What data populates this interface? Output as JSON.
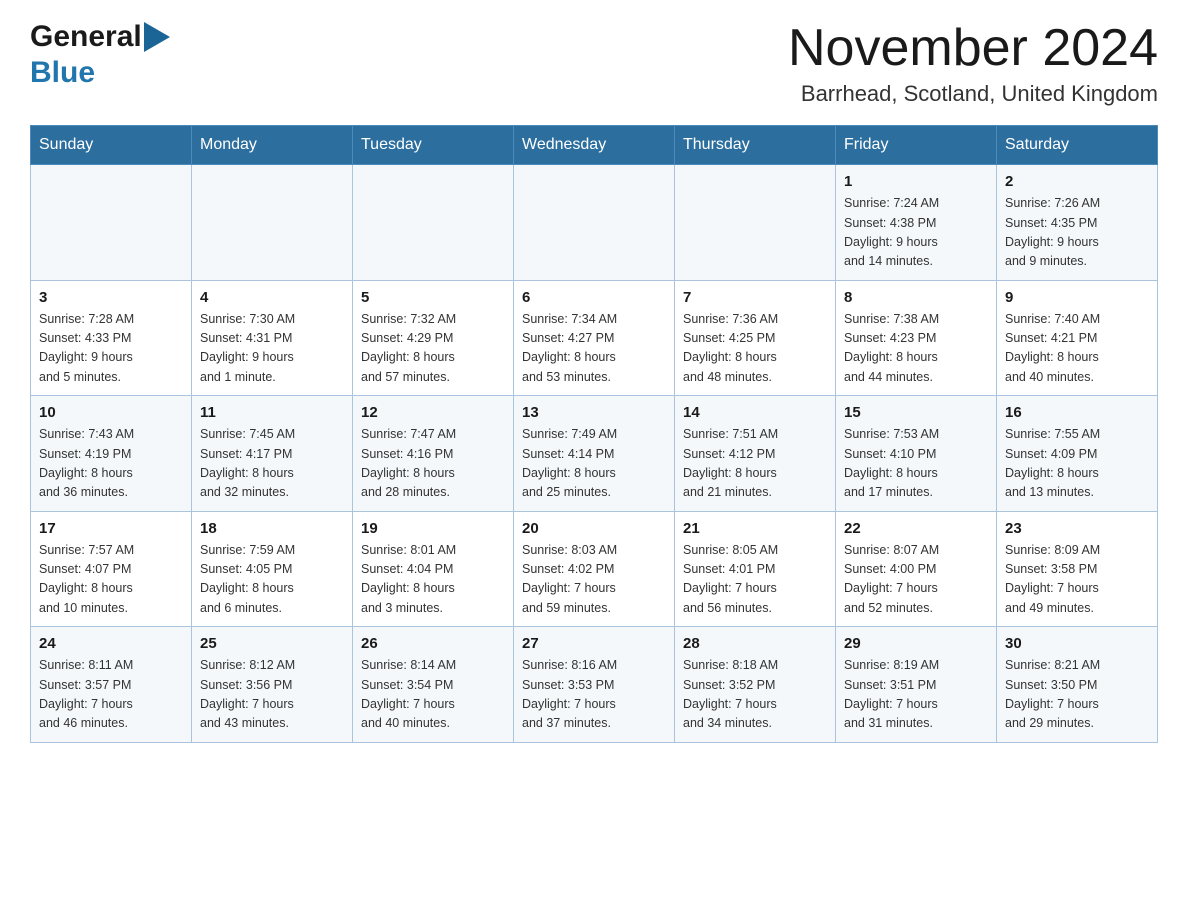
{
  "logo": {
    "general": "General",
    "blue": "Blue",
    "triangle_color": "#1a6496"
  },
  "title": {
    "month_year": "November 2024",
    "location": "Barrhead, Scotland, United Kingdom"
  },
  "weekdays": [
    "Sunday",
    "Monday",
    "Tuesday",
    "Wednesday",
    "Thursday",
    "Friday",
    "Saturday"
  ],
  "weeks": [
    [
      {
        "day": "",
        "info": ""
      },
      {
        "day": "",
        "info": ""
      },
      {
        "day": "",
        "info": ""
      },
      {
        "day": "",
        "info": ""
      },
      {
        "day": "",
        "info": ""
      },
      {
        "day": "1",
        "info": "Sunrise: 7:24 AM\nSunset: 4:38 PM\nDaylight: 9 hours\nand 14 minutes."
      },
      {
        "day": "2",
        "info": "Sunrise: 7:26 AM\nSunset: 4:35 PM\nDaylight: 9 hours\nand 9 minutes."
      }
    ],
    [
      {
        "day": "3",
        "info": "Sunrise: 7:28 AM\nSunset: 4:33 PM\nDaylight: 9 hours\nand 5 minutes."
      },
      {
        "day": "4",
        "info": "Sunrise: 7:30 AM\nSunset: 4:31 PM\nDaylight: 9 hours\nand 1 minute."
      },
      {
        "day": "5",
        "info": "Sunrise: 7:32 AM\nSunset: 4:29 PM\nDaylight: 8 hours\nand 57 minutes."
      },
      {
        "day": "6",
        "info": "Sunrise: 7:34 AM\nSunset: 4:27 PM\nDaylight: 8 hours\nand 53 minutes."
      },
      {
        "day": "7",
        "info": "Sunrise: 7:36 AM\nSunset: 4:25 PM\nDaylight: 8 hours\nand 48 minutes."
      },
      {
        "day": "8",
        "info": "Sunrise: 7:38 AM\nSunset: 4:23 PM\nDaylight: 8 hours\nand 44 minutes."
      },
      {
        "day": "9",
        "info": "Sunrise: 7:40 AM\nSunset: 4:21 PM\nDaylight: 8 hours\nand 40 minutes."
      }
    ],
    [
      {
        "day": "10",
        "info": "Sunrise: 7:43 AM\nSunset: 4:19 PM\nDaylight: 8 hours\nand 36 minutes."
      },
      {
        "day": "11",
        "info": "Sunrise: 7:45 AM\nSunset: 4:17 PM\nDaylight: 8 hours\nand 32 minutes."
      },
      {
        "day": "12",
        "info": "Sunrise: 7:47 AM\nSunset: 4:16 PM\nDaylight: 8 hours\nand 28 minutes."
      },
      {
        "day": "13",
        "info": "Sunrise: 7:49 AM\nSunset: 4:14 PM\nDaylight: 8 hours\nand 25 minutes."
      },
      {
        "day": "14",
        "info": "Sunrise: 7:51 AM\nSunset: 4:12 PM\nDaylight: 8 hours\nand 21 minutes."
      },
      {
        "day": "15",
        "info": "Sunrise: 7:53 AM\nSunset: 4:10 PM\nDaylight: 8 hours\nand 17 minutes."
      },
      {
        "day": "16",
        "info": "Sunrise: 7:55 AM\nSunset: 4:09 PM\nDaylight: 8 hours\nand 13 minutes."
      }
    ],
    [
      {
        "day": "17",
        "info": "Sunrise: 7:57 AM\nSunset: 4:07 PM\nDaylight: 8 hours\nand 10 minutes."
      },
      {
        "day": "18",
        "info": "Sunrise: 7:59 AM\nSunset: 4:05 PM\nDaylight: 8 hours\nand 6 minutes."
      },
      {
        "day": "19",
        "info": "Sunrise: 8:01 AM\nSunset: 4:04 PM\nDaylight: 8 hours\nand 3 minutes."
      },
      {
        "day": "20",
        "info": "Sunrise: 8:03 AM\nSunset: 4:02 PM\nDaylight: 7 hours\nand 59 minutes."
      },
      {
        "day": "21",
        "info": "Sunrise: 8:05 AM\nSunset: 4:01 PM\nDaylight: 7 hours\nand 56 minutes."
      },
      {
        "day": "22",
        "info": "Sunrise: 8:07 AM\nSunset: 4:00 PM\nDaylight: 7 hours\nand 52 minutes."
      },
      {
        "day": "23",
        "info": "Sunrise: 8:09 AM\nSunset: 3:58 PM\nDaylight: 7 hours\nand 49 minutes."
      }
    ],
    [
      {
        "day": "24",
        "info": "Sunrise: 8:11 AM\nSunset: 3:57 PM\nDaylight: 7 hours\nand 46 minutes."
      },
      {
        "day": "25",
        "info": "Sunrise: 8:12 AM\nSunset: 3:56 PM\nDaylight: 7 hours\nand 43 minutes."
      },
      {
        "day": "26",
        "info": "Sunrise: 8:14 AM\nSunset: 3:54 PM\nDaylight: 7 hours\nand 40 minutes."
      },
      {
        "day": "27",
        "info": "Sunrise: 8:16 AM\nSunset: 3:53 PM\nDaylight: 7 hours\nand 37 minutes."
      },
      {
        "day": "28",
        "info": "Sunrise: 8:18 AM\nSunset: 3:52 PM\nDaylight: 7 hours\nand 34 minutes."
      },
      {
        "day": "29",
        "info": "Sunrise: 8:19 AM\nSunset: 3:51 PM\nDaylight: 7 hours\nand 31 minutes."
      },
      {
        "day": "30",
        "info": "Sunrise: 8:21 AM\nSunset: 3:50 PM\nDaylight: 7 hours\nand 29 minutes."
      }
    ]
  ]
}
